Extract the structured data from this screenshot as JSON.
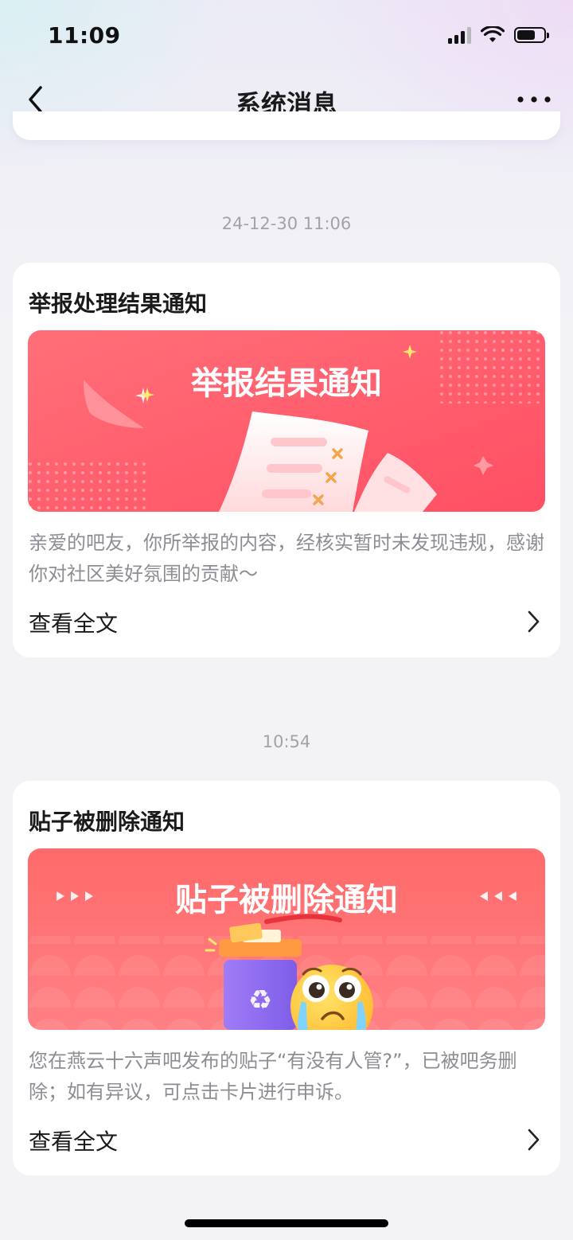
{
  "status_bar": {
    "time": "11:09"
  },
  "nav": {
    "title": "系统消息"
  },
  "messages": [
    {
      "timestamp": "24-12-30  11:06",
      "title": "举报处理结果通知",
      "banner_text": "举报结果通知",
      "description": "亲爱的吧友，你所举报的内容，经核实暂时未发现违规，感谢你对社区美好氛围的贡献～",
      "read_more": "查看全文"
    },
    {
      "timestamp": "10:54",
      "title": "贴子被删除通知",
      "banner_text": "贴子被删除通知",
      "description": "您在燕云十六声吧发布的贴子“有没有人管?”，已被吧务删除；如有异议，可点击卡片进行申诉。",
      "read_more": "查看全文"
    }
  ],
  "icons": {
    "back": "chevron-left-icon",
    "more": "more-dots-icon",
    "read_more": "chevron-right-icon",
    "signal": "cellular-signal-icon",
    "wifi": "wifi-icon",
    "battery": "battery-icon"
  },
  "colors": {
    "report_banner": "#ff5a6a",
    "delete_banner": "#ff6b6f",
    "timestamp": "#a2a2a8",
    "description": "#8d8d94"
  },
  "battery_level": 0.6,
  "signal_bars_active": 3
}
